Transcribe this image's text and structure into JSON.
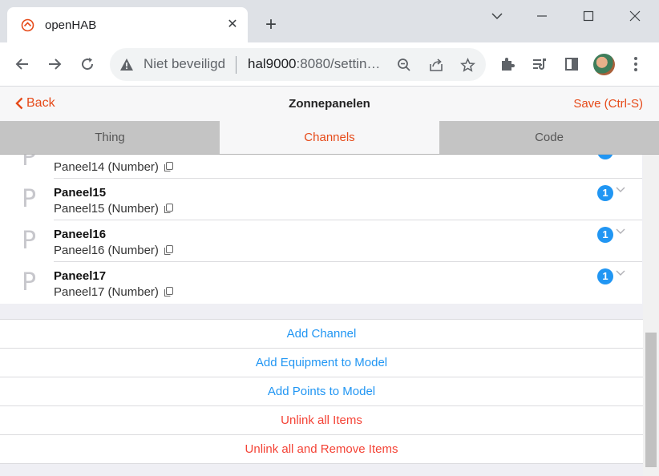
{
  "browser": {
    "tab_title": "openHAB",
    "security_label": "Niet beveiligd",
    "url_host": "hal9000",
    "url_rest": ":8080/settin…"
  },
  "app": {
    "back_label": "Back",
    "title": "Zonnepanelen",
    "save_label": "Save (Ctrl-S)",
    "tabs": [
      {
        "label": "Thing",
        "active": false
      },
      {
        "label": "Channels",
        "active": true
      },
      {
        "label": "Code",
        "active": false
      }
    ],
    "channels": [
      {
        "letter": "P",
        "name": "",
        "sub": "Paneel14 (Number)",
        "badge": "1"
      },
      {
        "letter": "P",
        "name": "Paneel15",
        "sub": "Paneel15 (Number)",
        "badge": "1"
      },
      {
        "letter": "P",
        "name": "Paneel16",
        "sub": "Paneel16 (Number)",
        "badge": "1"
      },
      {
        "letter": "P",
        "name": "Paneel17",
        "sub": "Paneel17 (Number)",
        "badge": "1"
      }
    ],
    "actions": [
      {
        "label": "Add Channel",
        "danger": false
      },
      {
        "label": "Add Equipment to Model",
        "danger": false
      },
      {
        "label": "Add Points to Model",
        "danger": false
      },
      {
        "label": "Unlink all Items",
        "danger": true
      },
      {
        "label": "Unlink all and Remove Items",
        "danger": true
      }
    ]
  },
  "colors": {
    "accent": "#e64a19",
    "link": "#2196f3",
    "danger": "#f44336",
    "badge": "#2196f3"
  },
  "icons": {
    "tab_favicon": "openhab-logo-icon",
    "tab_close": "close-icon",
    "new_tab": "plus-icon",
    "back": "arrow-left-icon",
    "forward": "arrow-right-icon",
    "reload": "reload-icon",
    "security": "warning-icon",
    "zoom": "zoom-out-icon",
    "share": "share-icon",
    "bookmark": "star-icon",
    "extensions": "puzzle-icon",
    "media": "media-queue-icon",
    "side_panel": "side-panel-icon",
    "menu": "three-dots-icon",
    "copy": "copy-icon",
    "chevron": "chevron-down-icon"
  }
}
